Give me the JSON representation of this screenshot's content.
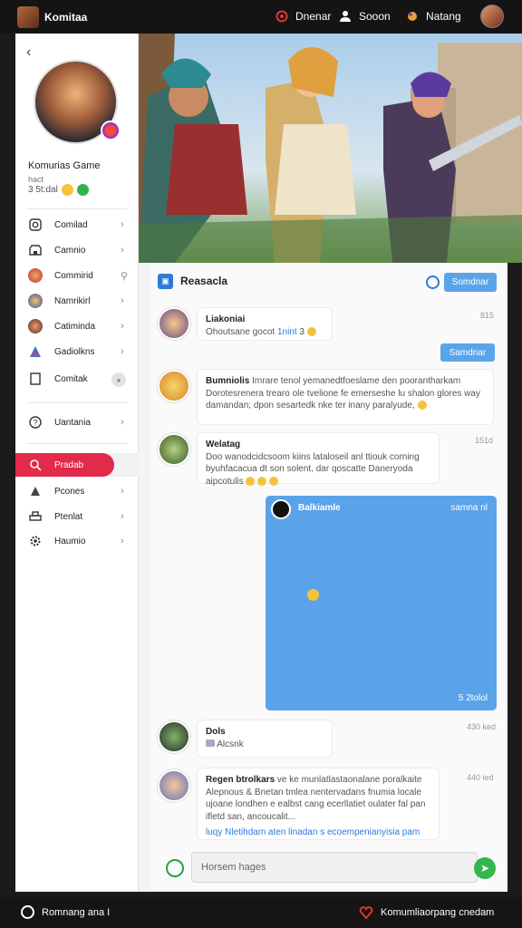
{
  "topbar": {
    "brand": "Komitaa",
    "items": [
      {
        "label": "Dnenar",
        "icon": "target-icon"
      },
      {
        "label": "Sooon",
        "icon": "user-icon"
      },
      {
        "label": "Natang",
        "icon": "planet-icon"
      }
    ]
  },
  "sidebar": {
    "back": "‹",
    "profile": {
      "name": "Komurias Game",
      "sub": "hact",
      "stat": "3 5t:dal"
    },
    "items": [
      {
        "label": "Comilad",
        "icon": "instagram-icon"
      },
      {
        "label": "Camnio",
        "icon": "store-icon"
      },
      {
        "label": "Commirid",
        "icon": "avatar-icon"
      },
      {
        "label": "Namrikirl",
        "icon": "avatar-icon"
      },
      {
        "label": "Catiminda",
        "icon": "avatar-icon"
      },
      {
        "label": "Gadiolkns",
        "icon": "app-icon"
      },
      {
        "label": "Comitak",
        "icon": "doc-icon"
      }
    ],
    "items2": [
      {
        "label": "Uantania",
        "icon": "question-icon"
      }
    ],
    "items3": [
      {
        "label": "Pradab",
        "icon": "search-icon",
        "active": true
      },
      {
        "label": "Pcones",
        "icon": "person-icon"
      },
      {
        "label": "Ptenlat",
        "icon": "print-icon"
      },
      {
        "label": "Haumio",
        "icon": "gear-icon"
      }
    ]
  },
  "channel": {
    "title": "Reasacla",
    "header_button": "Somdnar"
  },
  "messages": [
    {
      "name": "Liakoniai",
      "text": "Ohoutsane gocot",
      "link": "1nint",
      "count": "3",
      "time": "815"
    },
    {
      "self_button": "Samdnar"
    },
    {
      "name": "Bumniolis",
      "text": "Imrare tenol yemanedtfoeslame den poorantharkam Dorotesrenera trearo ole tvelione fe emerseshe lu shalon glores way damandan; dpon sesartedk nke ter inany paralyude,",
      "time": ""
    },
    {
      "name": "Welatag",
      "text": "Doo wanodcidcsoom kiins lataloseil anl ttiouk corning byuhfacacua dt son solent, dar qoscatte Daneryoda aipcotulis",
      "time": "151d"
    },
    {
      "name": "Balkiamle",
      "time": "samna nl",
      "foot": "5 2tolol"
    },
    {
      "name": "Dols",
      "text": "Alcsnk",
      "time": "430 ked"
    },
    {
      "name": "Regen btrolkars",
      "text": "ve ke munlatlastaonalane poralkaite Alepnous & Bnetan tmlea nentervadans fnumia locale ujoane londhen e ealbst cang ecerllatiet oulater fal pan ifletd san, ancoucalit...",
      "link": "luqy Nletihdam aten linadan s ecoempenianyisia pam",
      "time": "440 ied"
    }
  ],
  "composer": {
    "placeholder": "Horsem hages"
  },
  "bottombar": {
    "left": "Romnang ana I",
    "right": "Komumliaorpang cnedam"
  }
}
